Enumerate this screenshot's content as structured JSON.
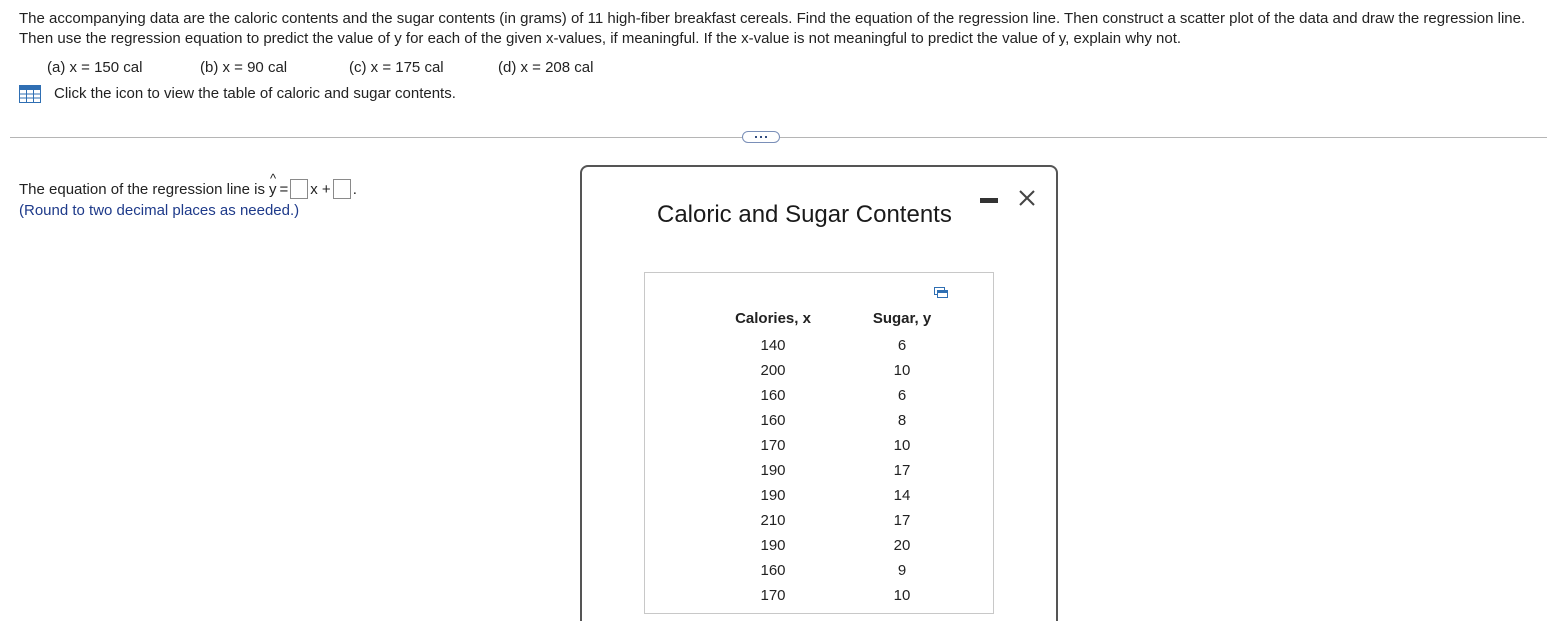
{
  "question": {
    "text": "The accompanying data are the caloric contents and the sugar contents (in grams) of 11 high-fiber breakfast cereals. Find the equation of the regression line. Then construct a scatter plot of the data and draw the regression line. Then use the regression equation to predict the value of y for each of the given x-values, if meaningful. If the x-value is not meaningful to predict the value of y, explain why not.",
    "parts": [
      "(a) x = 150 cal",
      "(b) x = 90 cal",
      "(c) x = 175 cal",
      "(d) x = 208 cal"
    ],
    "table_link": "Click the icon to view the table of caloric and sugar contents.",
    "icons": {
      "table": "table-grid-icon",
      "more": "more-dots-icon"
    }
  },
  "answer": {
    "prefix": "The equation of the regression line is ",
    "yhat": "y",
    "equals": "=",
    "x_plus": "x +",
    "period": ".",
    "hint": "(Round to two decimal places as needed.)",
    "slope_value": "",
    "intercept_value": ""
  },
  "popup": {
    "title": "Caloric and Sugar Contents",
    "icons": {
      "minimize": "minimize-icon",
      "close": "close-icon",
      "copy": "copy-icon"
    },
    "headers": [
      "Calories, x",
      "Sugar, y"
    ],
    "rows": [
      [
        "140",
        "6"
      ],
      [
        "200",
        "10"
      ],
      [
        "160",
        "6"
      ],
      [
        "160",
        "8"
      ],
      [
        "170",
        "10"
      ],
      [
        "190",
        "17"
      ],
      [
        "190",
        "14"
      ],
      [
        "210",
        "17"
      ],
      [
        "190",
        "20"
      ],
      [
        "160",
        "9"
      ],
      [
        "170",
        "10"
      ]
    ]
  },
  "colors": {
    "link_icon": "#2f6fb3",
    "hint_text": "#1e3a8a",
    "divider": "#b5b5b5",
    "popup_border": "#555555"
  }
}
